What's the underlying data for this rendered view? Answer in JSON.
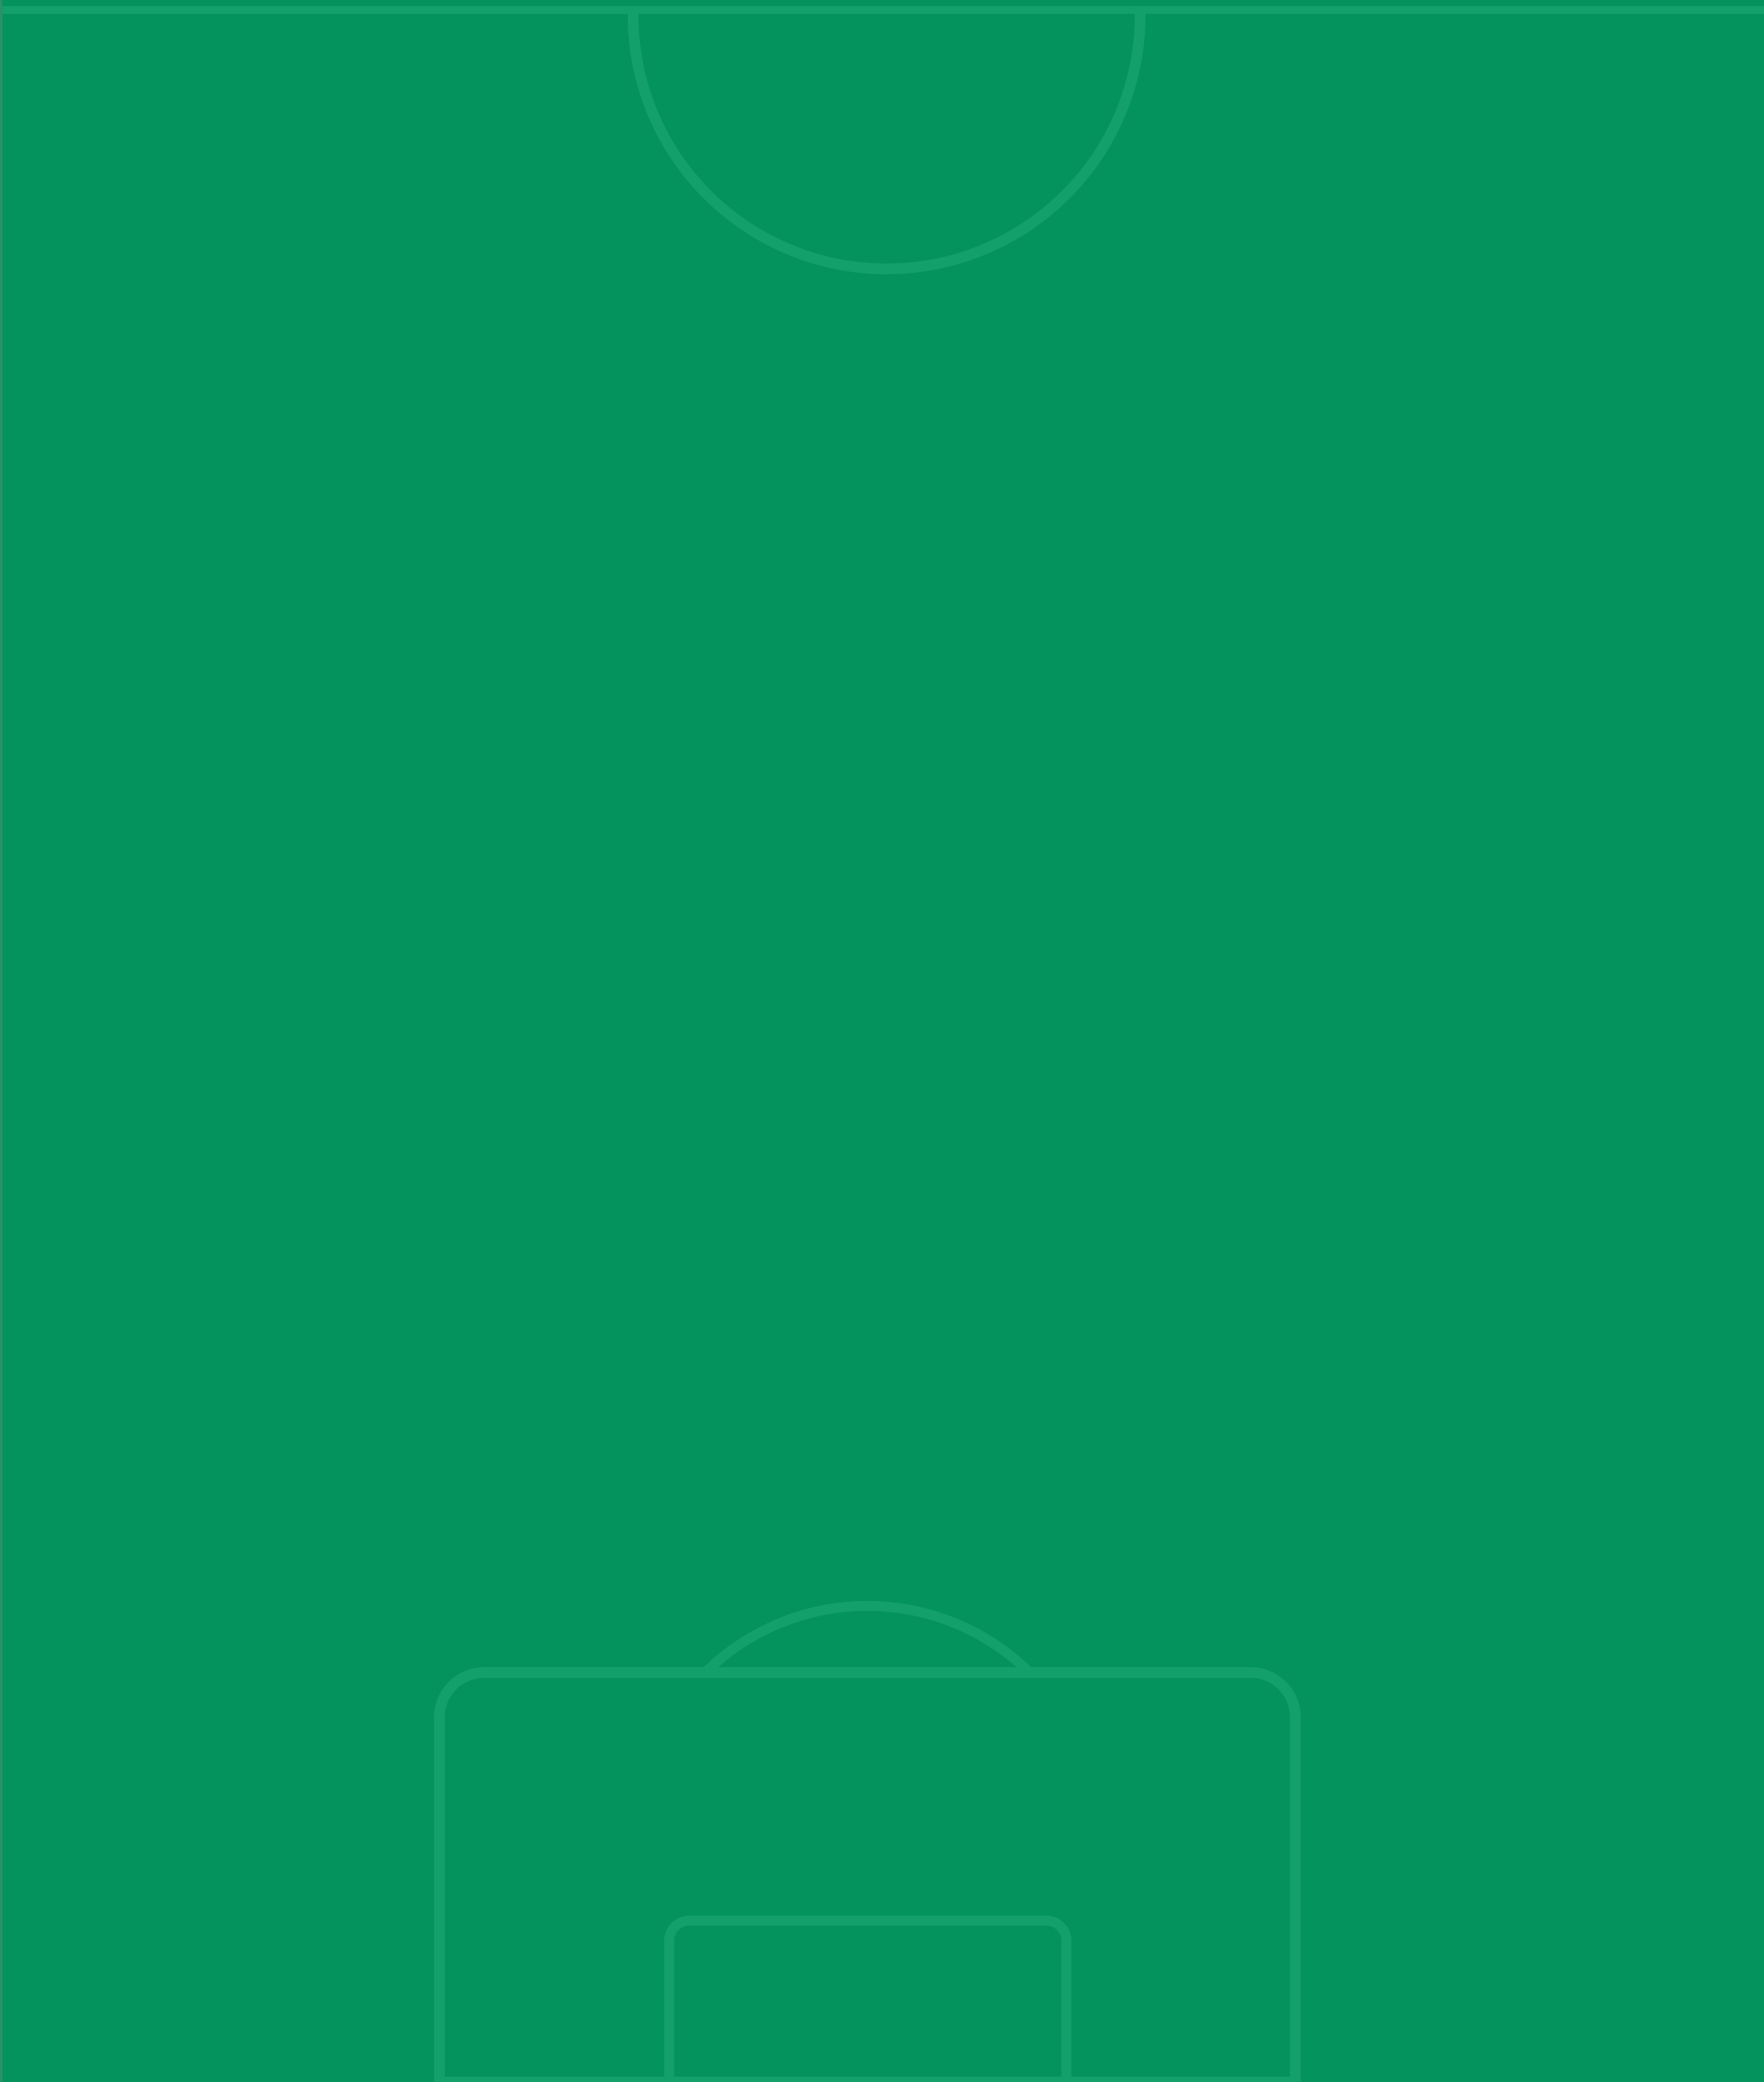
{
  "pitch": {
    "view": "half-pitch",
    "colors": {
      "grass": "#04935C",
      "lines": "#14A06A",
      "edge": "#2F8F6B"
    }
  }
}
